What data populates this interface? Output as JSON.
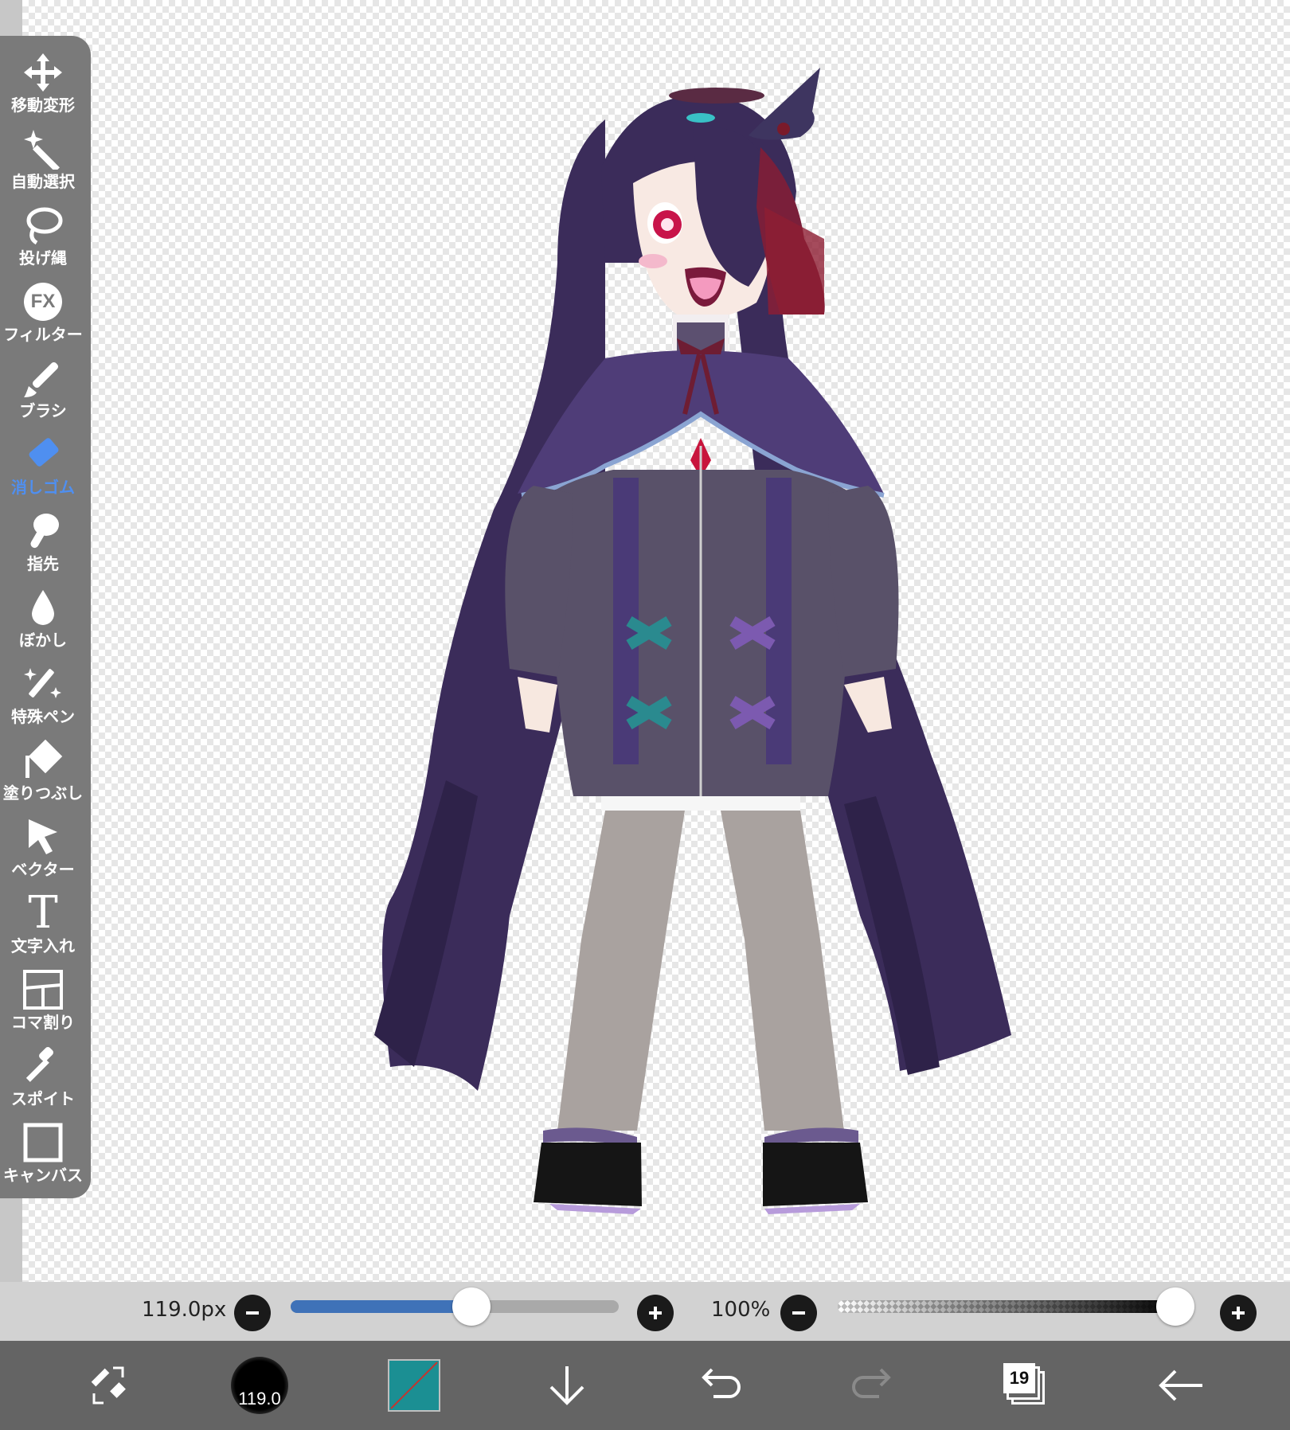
{
  "toolbar": {
    "tools": [
      {
        "id": "transform",
        "label": "移動変形",
        "icon": "move-arrows-icon"
      },
      {
        "id": "magic-wand",
        "label": "自動選択",
        "icon": "magic-wand-icon"
      },
      {
        "id": "lasso",
        "label": "投げ縄",
        "icon": "lasso-icon"
      },
      {
        "id": "filter",
        "label": "フィルター",
        "icon": "fx-icon",
        "icon_text": "FX"
      },
      {
        "id": "brush",
        "label": "ブラシ",
        "icon": "brush-icon"
      },
      {
        "id": "eraser",
        "label": "消しゴム",
        "icon": "eraser-icon",
        "active": true
      },
      {
        "id": "smudge",
        "label": "指先",
        "icon": "finger-smudge-icon"
      },
      {
        "id": "blur",
        "label": "ぼかし",
        "icon": "water-drop-icon"
      },
      {
        "id": "special-pen",
        "label": "特殊ペン",
        "icon": "sparkle-pen-icon"
      },
      {
        "id": "fill",
        "label": "塗りつぶし",
        "icon": "fill-bucket-icon"
      },
      {
        "id": "vector",
        "label": "ベクター",
        "icon": "cursor-arrow-icon"
      },
      {
        "id": "text",
        "label": "文字入れ",
        "icon": "text-t-icon",
        "icon_text": "T"
      },
      {
        "id": "frame",
        "label": "コマ割り",
        "icon": "frame-divider-icon"
      },
      {
        "id": "eyedropper",
        "label": "スポイト",
        "icon": "eyedropper-icon"
      },
      {
        "id": "canvas",
        "label": "キャンバス",
        "icon": "canvas-square-icon"
      }
    ]
  },
  "brush_settings": {
    "size_label": "119.0px",
    "size_fraction": 0.55,
    "opacity_label": "100%",
    "opacity_fraction": 1.0
  },
  "bottom_bar": {
    "brush_size_preview": "119.0",
    "layer_count": "19"
  },
  "colors": {
    "accent": "#4f8ff0",
    "slider_fill": "#3f72b8",
    "current_color": "#1b8f93",
    "toolbar_bg": "#7a7a7a",
    "bottom_bar_bg": "#646464"
  }
}
